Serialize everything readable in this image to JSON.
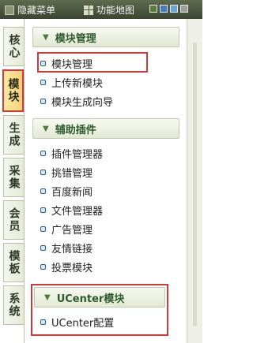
{
  "topbar": {
    "hide_menu": "隐藏菜单",
    "function_map": "功能地图"
  },
  "colors": {
    "accent_red": "#d23a3a",
    "header_green": "#2d5c2e"
  },
  "tabs": [
    {
      "label": "核心"
    },
    {
      "label": "模块"
    },
    {
      "label": "生成"
    },
    {
      "label": "采集"
    },
    {
      "label": "会员"
    },
    {
      "label": "模板"
    },
    {
      "label": "系统"
    }
  ],
  "sections": [
    {
      "title": "模块管理",
      "items": [
        "模块管理",
        "上传新模块",
        "模块生成向导"
      ]
    },
    {
      "title": "辅助插件",
      "items": [
        "插件管理器",
        "挑错管理",
        "百度新闻",
        "文件管理器",
        "广告管理",
        "友情链接",
        "投票模块"
      ]
    },
    {
      "title": "UCenter模块",
      "items": [
        "UCenter配置"
      ]
    }
  ]
}
